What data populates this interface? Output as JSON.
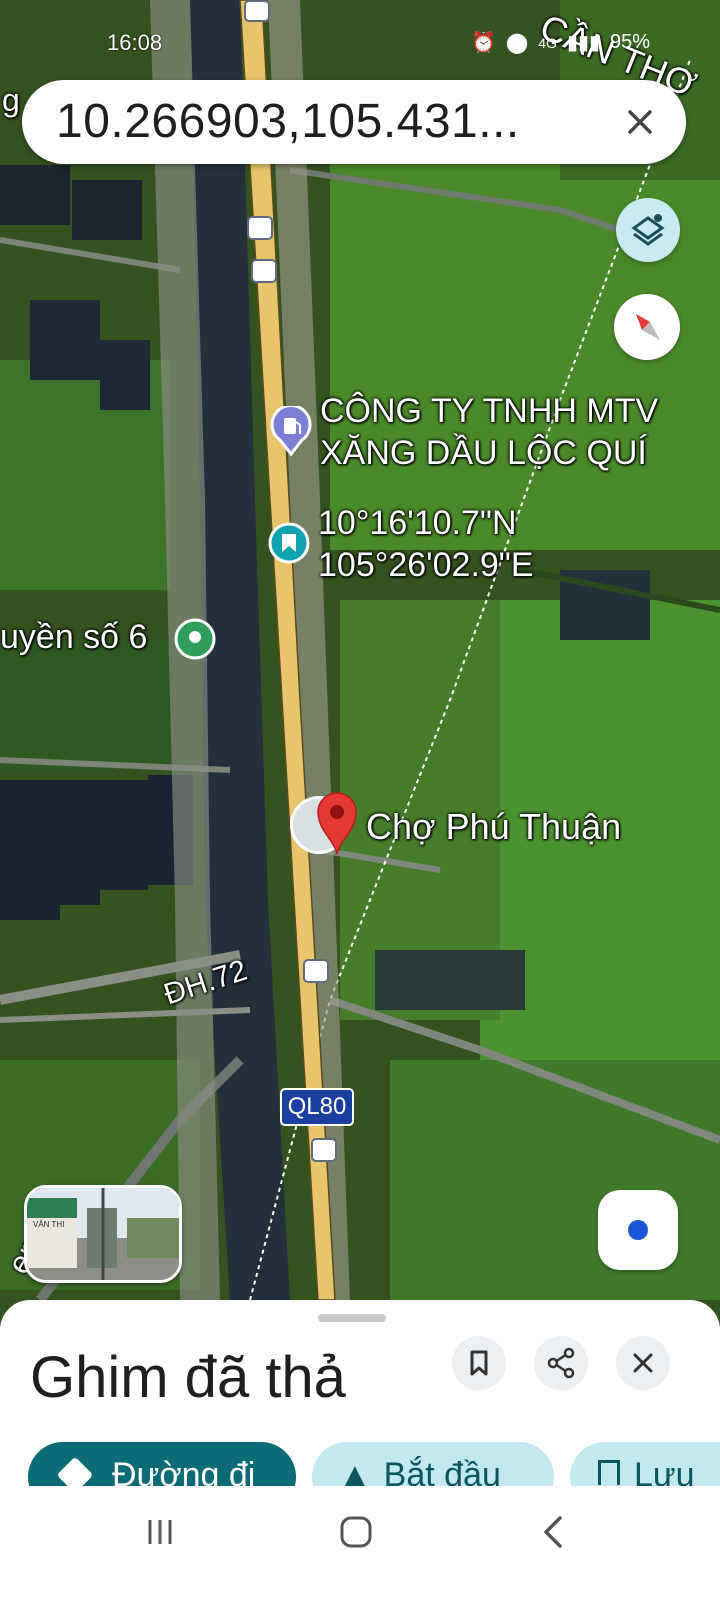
{
  "status_bar": {
    "time": "16:08",
    "network": "4G",
    "battery": "95%"
  },
  "search": {
    "query": "10.266903,105.431..."
  },
  "map": {
    "labels": {
      "city": "CẦN THƠ",
      "gas_station_line1": "CÔNG TY TNHH MTV",
      "gas_station_line2": "XĂNG DẦU LỘC QUÍ",
      "coords_line1": "10°16'10.7\"N",
      "coords_line2": "105°26'02.9\"E",
      "left_place": "uyền số 6",
      "market": "Chợ Phú Thuận",
      "road_dh": "ĐH.72",
      "road_ql": "QL80",
      "edge_top_left": "g",
      "edge_bottom_left": "en"
    },
    "colors": {
      "pin": "#e53935",
      "highway": "#e8c46a",
      "field": "#3f7a2c",
      "canal": "#26303a"
    },
    "icons": [
      "bus-stop-icon",
      "gas-station-icon",
      "saved-place-icon",
      "place-marker-icon",
      "dropped-pin-icon"
    ]
  },
  "controls": {
    "layers_icon": "layers-icon",
    "compass_icon": "compass-icon",
    "my_location_icon": "my-location-icon",
    "streetview_sign": "VĂN THI"
  },
  "sheet": {
    "title": "Ghim đã thả",
    "actions": {
      "directions": "Đường đi",
      "start": "Bắt đầu",
      "save": "Lưu"
    },
    "icon_buttons": [
      "bookmark-icon",
      "share-icon",
      "close-icon"
    ]
  },
  "nav_bar": {
    "icons": [
      "recent-apps-icon",
      "home-icon",
      "back-icon"
    ]
  }
}
